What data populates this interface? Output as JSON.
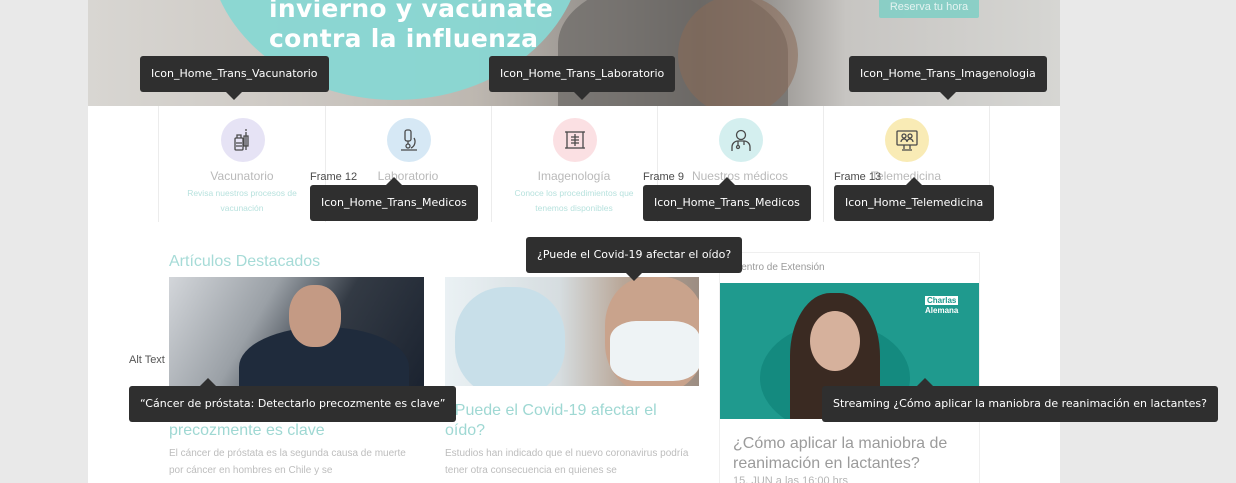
{
  "hero": {
    "title_line1": "invierno y vacúnate",
    "title_line2": "contra la influenza",
    "reserve_button": "Reserva tu hora"
  },
  "services": [
    {
      "name": "Vacunatorio",
      "desc": "Revisa nuestros procesos de vacunación",
      "icon": "syringe-vial-icon",
      "color": "#e6e3f5"
    },
    {
      "name": "Laboratorio",
      "desc": "",
      "icon": "microscope-icon",
      "color": "#d6e8f5"
    },
    {
      "name": "Imagenología",
      "desc": "Conoce los procedimientos que tenemos disponibles",
      "icon": "xray-icon",
      "color": "#fbe0e3"
    },
    {
      "name": "Nuestros médicos",
      "desc": "",
      "icon": "doctor-icon",
      "color": "#d4efef"
    },
    {
      "name": "Telemedicina",
      "desc": "",
      "icon": "monitor-doctors-icon",
      "color": "#f9ebb5"
    }
  ],
  "frames": {
    "f12": "Frame 12",
    "f9": "Frame 9",
    "f13": "Frame 13"
  },
  "alt_text_label": "Alt Text",
  "tooltips": {
    "vacunatorio": "Icon_Home_Trans_Vacunatorio",
    "laboratorio": "Icon_Home_Trans_Laboratorio",
    "imagenologia": "Icon_Home_Trans_Imagenologia",
    "medicos1": "Icon_Home_Trans_Medicos",
    "medicos2": "Icon_Home_Trans_Medicos",
    "telemedicina": "Icon_Home_Telemedicina",
    "covid": "¿Puede el Covid-19 afectar el oído?",
    "cancer": "“Cáncer de próstata: Detectarlo precozmente es clave”",
    "streaming": "Streaming ¿Cómo aplicar la maniobra de reanimación en lactantes?"
  },
  "articles": {
    "heading": "Artículos Destacados",
    "items": [
      {
        "title_visible": "precozmente es clave",
        "text": "El cáncer de próstata es la segunda causa de muerte por cáncer en hombres en Chile y se"
      },
      {
        "title": "¿Puede el Covid-19 afectar el oído?",
        "text": "Estudios han indicado que el nuevo coronavirus podría tener otra consecuencia en quienes se"
      }
    ]
  },
  "extension": {
    "category": "Centro de Extensión",
    "brand_line1": "Charlas",
    "brand_line2": "Alemana",
    "title": "¿Cómo aplicar la maniobra de reanimación en lactantes?",
    "date": "15, JUN a las 16:00 hrs"
  },
  "colors": {
    "accent_teal": "#9fd8d3",
    "tooltip_bg": "#2f2f2f",
    "banner_teal": "#1f9a8e"
  }
}
